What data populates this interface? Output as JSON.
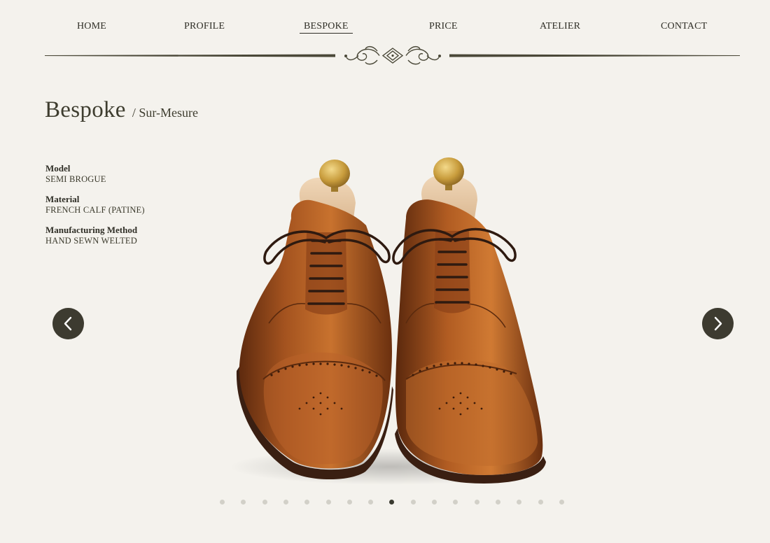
{
  "nav": {
    "items": [
      {
        "label": "HOME",
        "active": false
      },
      {
        "label": "PROFILE",
        "active": false
      },
      {
        "label": "BESPOKE",
        "active": true
      },
      {
        "label": "PRICE",
        "active": false
      },
      {
        "label": "ATELIER",
        "active": false
      },
      {
        "label": "CONTACT",
        "active": false
      }
    ]
  },
  "page": {
    "title": "Bespoke",
    "subtitle": "/ Sur-Mesure"
  },
  "specs": [
    {
      "label": "Model",
      "value": "SEMI BROGUE"
    },
    {
      "label": "Material",
      "value": "FRENCH CALF (PATINE)"
    },
    {
      "label": "Manufacturing Method",
      "value": "HAND SEWN WELTED"
    }
  ],
  "carousel": {
    "prev_icon": "chevron-left-icon",
    "next_icon": "chevron-right-icon",
    "image": "pair of brown semi-brogue oxford shoes with brass shoe trees",
    "slide_count": 17,
    "active_index": 8
  },
  "colors": {
    "background": "#f4f2ed",
    "text": "#3b3a2c",
    "arrow_bg": "#3d3b30",
    "dot_inactive": "#d2d0c8",
    "dot_active": "#3a3a30",
    "leather": "#9a4a1c"
  }
}
